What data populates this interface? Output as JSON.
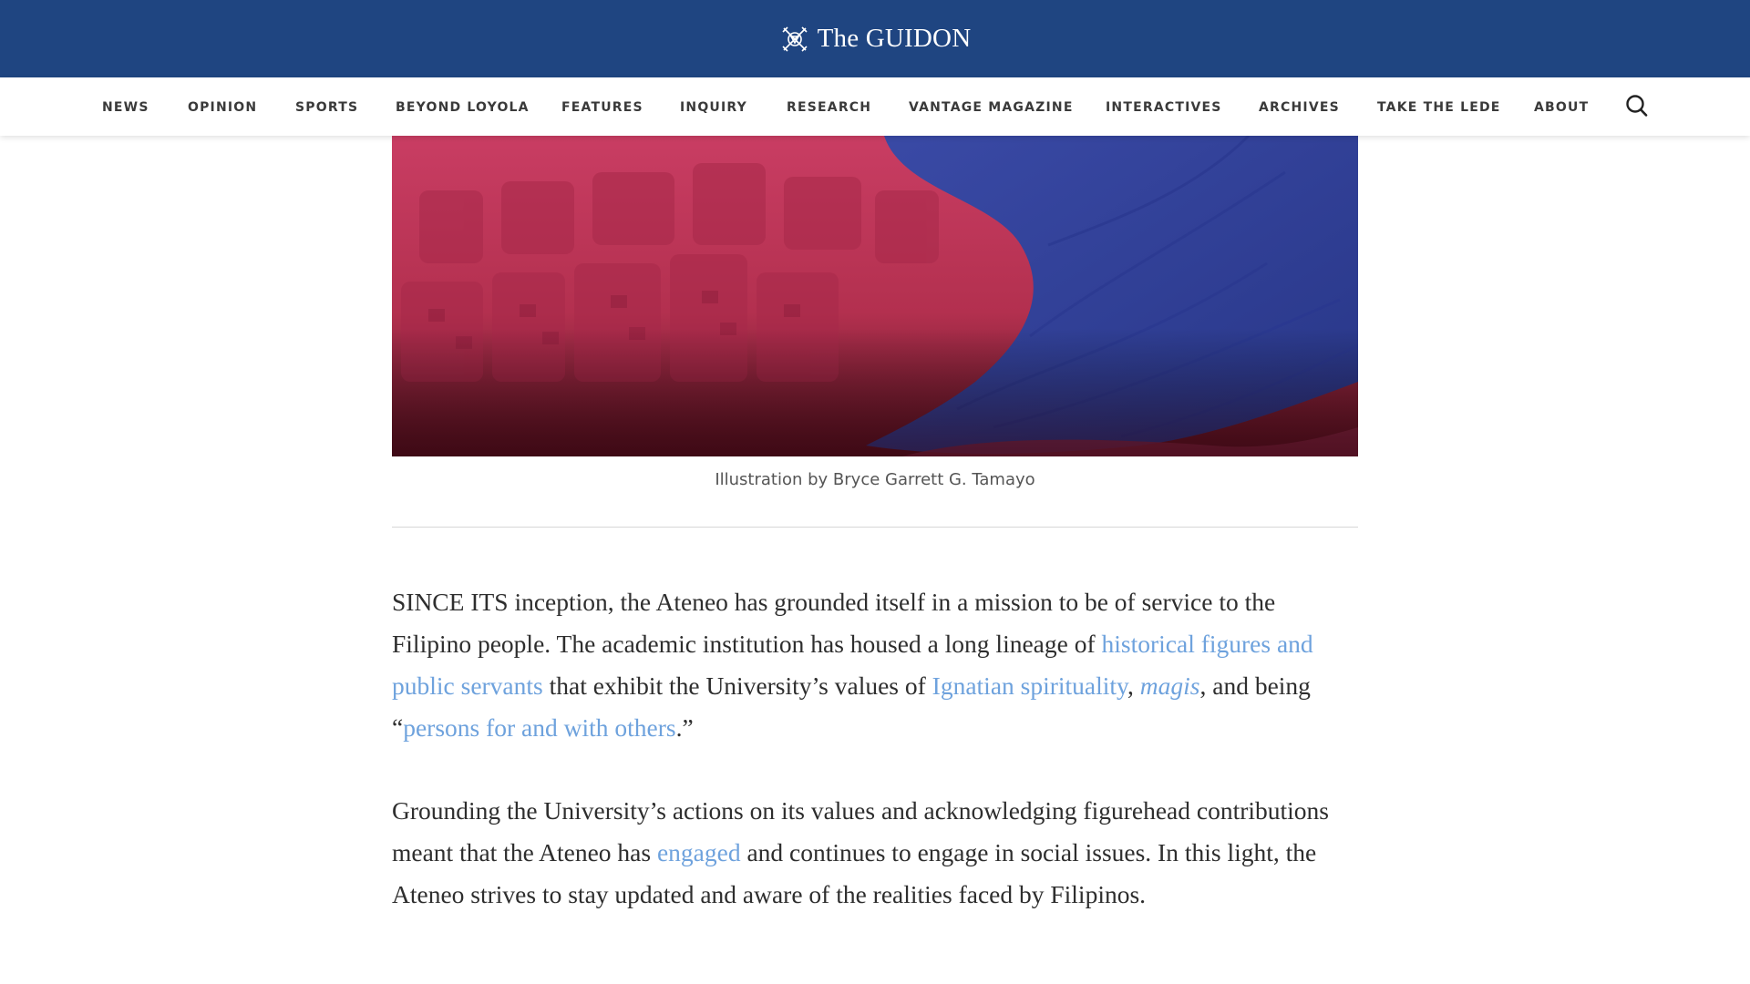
{
  "site": {
    "name": "The GUIDON",
    "logo_icon": "guidon-crest-icon"
  },
  "colors": {
    "brand_blue": "#1f4581",
    "link": "#6ea2dd",
    "text": "#2e2e2e"
  },
  "nav": {
    "items": [
      {
        "label": "NEWS"
      },
      {
        "label": "OPINION"
      },
      {
        "label": "SPORTS"
      },
      {
        "label": "BEYOND LOYOLA"
      },
      {
        "label": "FEATURES"
      },
      {
        "label": "INQUIRY"
      },
      {
        "label": "RESEARCH"
      },
      {
        "label": "VANTAGE MAGAZINE"
      },
      {
        "label": "INTERACTIVES"
      },
      {
        "label": "ARCHIVES"
      },
      {
        "label": "TAKE THE LEDE"
      },
      {
        "label": "ABOUT"
      }
    ],
    "search_icon": "search-icon"
  },
  "hero": {
    "caption": "Illustration by Bryce Garrett G. Tamayo"
  },
  "article": {
    "p1": {
      "t1": "SINCE ITS inception, the Ateneo has grounded itself in a mission to be of service to the Filipino people. The academic institution has housed a long lineage of ",
      "l1": "historical figures and public servants",
      "t2": " that exhibit the University’s values of ",
      "l2": "Ignatian spirituality",
      "t3": ", ",
      "l3": "magis",
      "t4": ", and being “",
      "l4": "persons for and with others",
      "t5": ".”"
    },
    "p2": {
      "t1": "Grounding the University’s actions on its values and acknowledging figurehead contributions meant that the Ateneo has ",
      "l1": "engaged",
      "t2": " and continues to engage in social issues. In this light, the Ateneo strives to stay updated and aware of the realities faced by Filipinos."
    }
  }
}
